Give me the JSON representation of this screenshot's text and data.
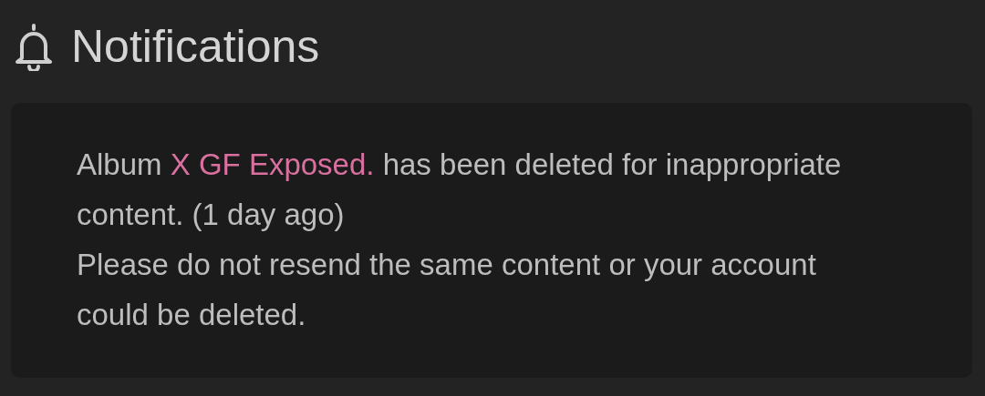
{
  "title": "Notifications",
  "notification": {
    "prefix": "Album ",
    "link": "X GF Exposed.",
    "suffix": " has been deleted for inappropriate content. (1 day ago)",
    "warning": "Please do not resend the same content or your account could be deleted."
  }
}
